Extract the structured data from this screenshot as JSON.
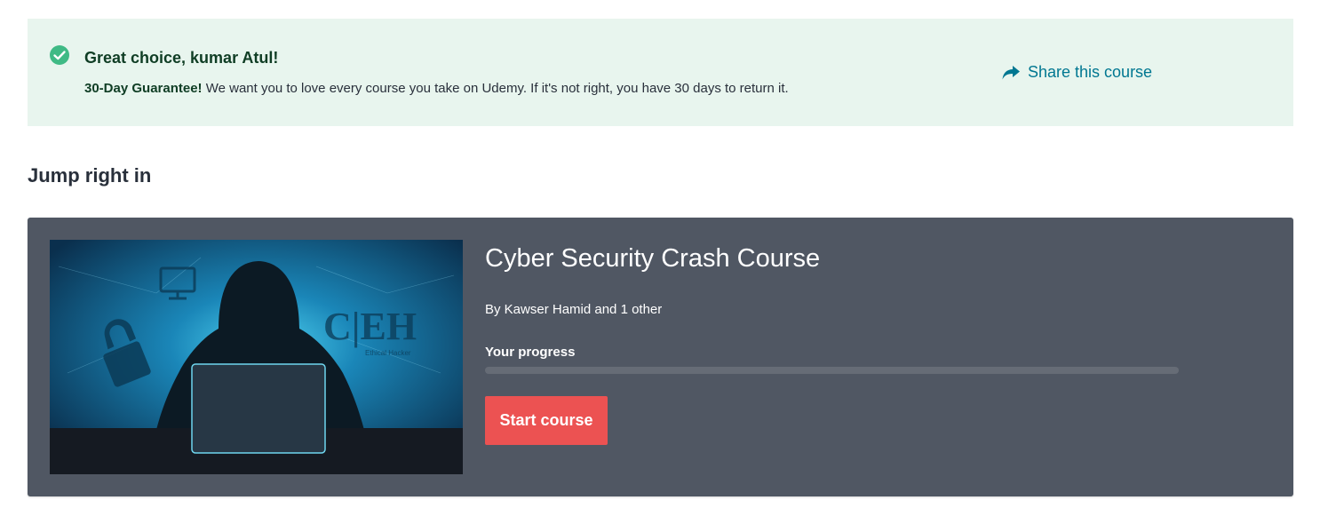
{
  "banner": {
    "title": "Great choice, kumar Atul!",
    "guarantee_bold": "30-Day Guarantee!",
    "guarantee_text": " We want you to love every course you take on Udemy. If it's not right, you have 30 days to return it.",
    "share_label": "Share this course",
    "icons": {
      "status": "check-circle-icon",
      "share": "share-arrow-icon"
    }
  },
  "section": {
    "title": "Jump right in"
  },
  "course": {
    "title": "Cyber Security Crash Course",
    "author": "By Kawser Hamid and 1 other",
    "progress_label": "Your progress",
    "progress_percent": 0,
    "start_label": "Start course",
    "thumbnail": {
      "subject": "hooded figure at laptop",
      "text": "C|EH",
      "subtext": "Ethical Hacker"
    }
  },
  "colors": {
    "banner_bg": "#e8f5ee",
    "card_bg": "#505763",
    "accent": "#ec5252",
    "link": "#007791",
    "success": "#3fba85"
  }
}
